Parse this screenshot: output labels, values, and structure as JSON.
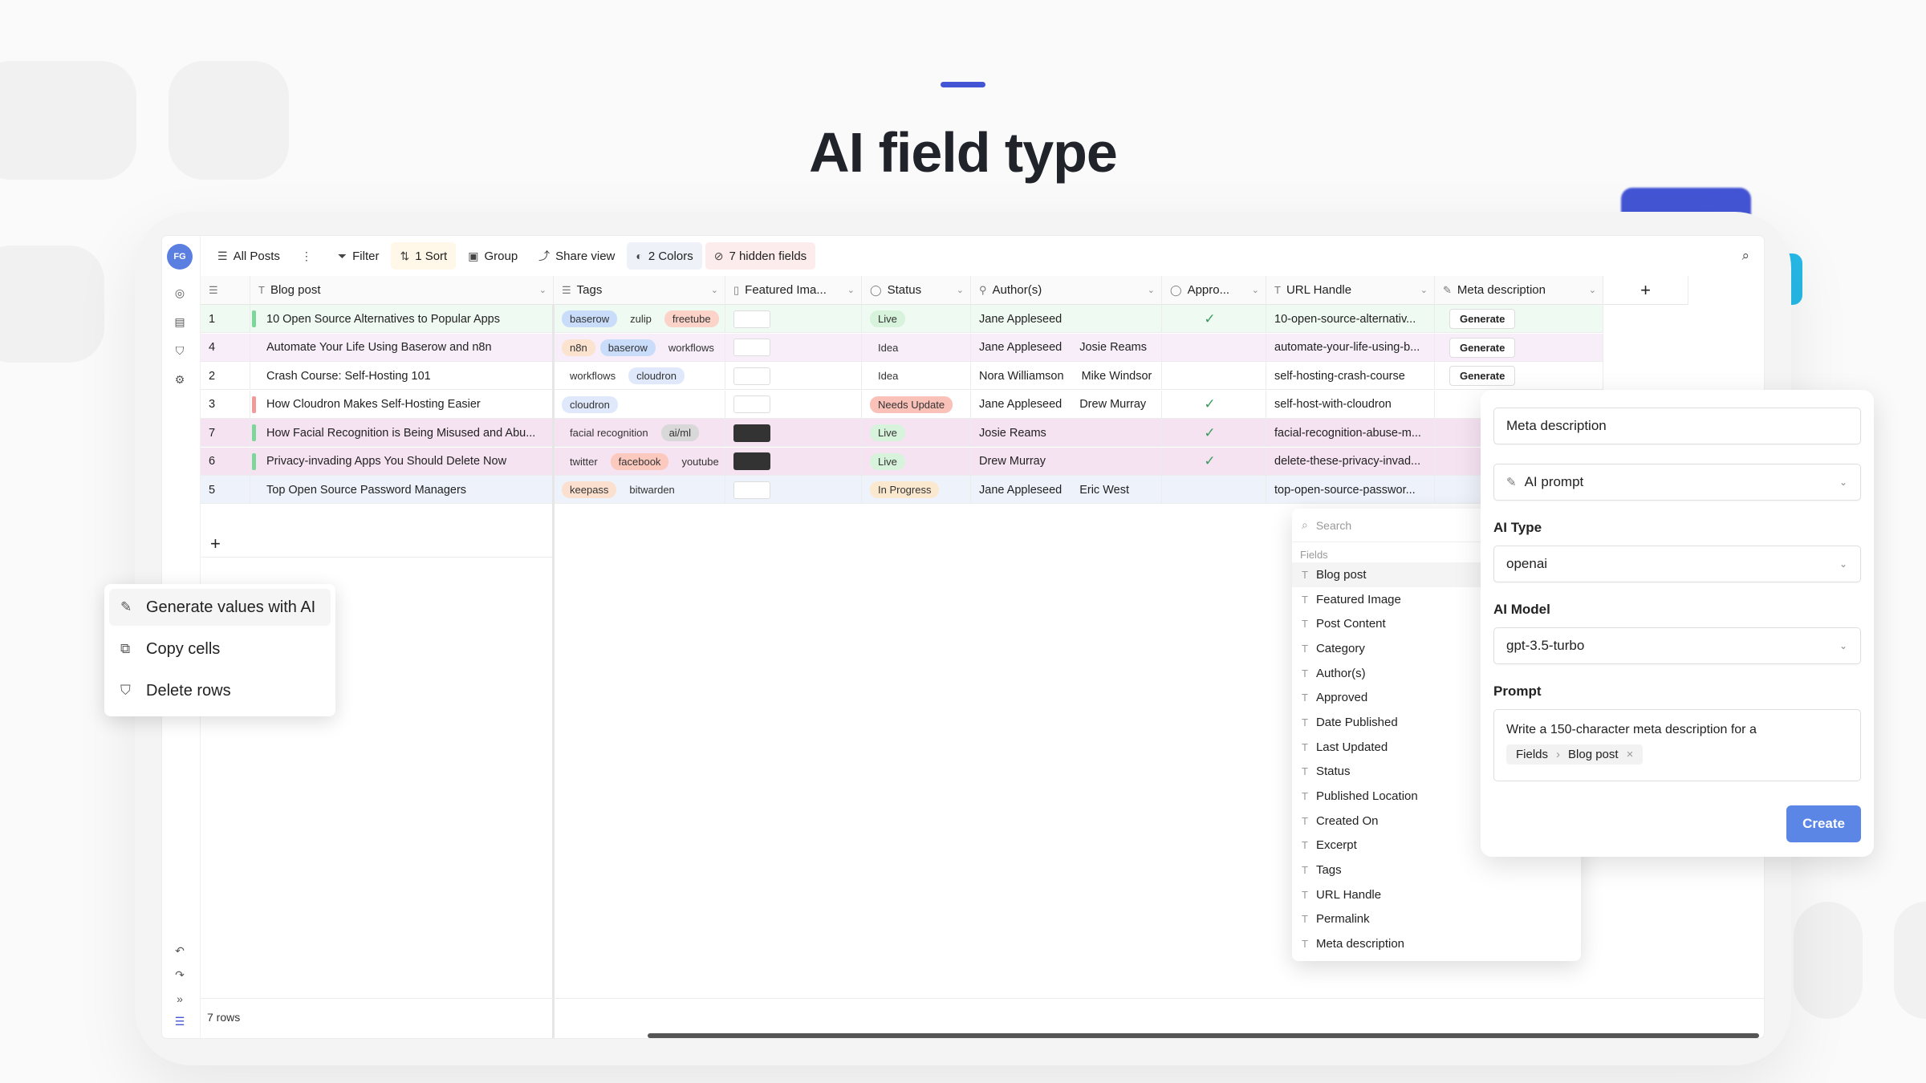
{
  "hero": {
    "title": "AI field type"
  },
  "sidebar": {
    "avatar": "FG"
  },
  "toolbar": {
    "view_name": "All Posts",
    "filter": "Filter",
    "sort": "1 Sort",
    "group": "Group",
    "share": "Share view",
    "colors": "2 Colors",
    "hidden": "7 hidden fields"
  },
  "columns": [
    "Blog post",
    "Tags",
    "Featured Ima...",
    "Status",
    "Author(s)",
    "Appro...",
    "URL Handle",
    "Meta description"
  ],
  "rows": [
    {
      "id": "1",
      "title": "10 Open Source Alternatives to Popular Apps",
      "tags": [
        "baserow",
        "zulip",
        "freetube"
      ],
      "status": "Live",
      "authors": [
        "Jane Appleseed"
      ],
      "approved": "✓",
      "url": "10-open-source-alternativ...",
      "meta": "Generate"
    },
    {
      "id": "4",
      "title": "Automate Your Life Using Baserow and n8n",
      "tags": [
        "n8n",
        "baserow",
        "workflows"
      ],
      "status": "Idea",
      "authors": [
        "Jane Appleseed",
        "Josie Reams"
      ],
      "approved": "",
      "url": "automate-your-life-using-b...",
      "meta": "Generate"
    },
    {
      "id": "2",
      "title": "Crash Course: Self-Hosting 101",
      "tags": [
        "workflows",
        "cloudron"
      ],
      "status": "Idea",
      "authors": [
        "Nora Williamson",
        "Mike Windsor"
      ],
      "approved": "",
      "url": "self-hosting-crash-course",
      "meta": "Generate"
    },
    {
      "id": "3",
      "title": "How Cloudron Makes Self-Hosting Easier",
      "tags": [
        "cloudron"
      ],
      "status": "Needs Update",
      "authors": [
        "Jane Appleseed",
        "Drew Murray"
      ],
      "approved": "✓",
      "url": "self-host-with-cloudron",
      "meta": ""
    },
    {
      "id": "7",
      "title": "How Facial Recognition is Being Misused and Abu...",
      "tags": [
        "facial recognition",
        "ai/ml"
      ],
      "status": "Live",
      "authors": [
        "Josie Reams"
      ],
      "approved": "✓",
      "url": "facial-recognition-abuse-m...",
      "meta": ""
    },
    {
      "id": "6",
      "title": "Privacy-invading Apps You Should Delete Now",
      "tags": [
        "twitter",
        "facebook",
        "youtube"
      ],
      "status": "Live",
      "authors": [
        "Drew Murray"
      ],
      "approved": "✓",
      "url": "delete-these-privacy-invad...",
      "meta": ""
    },
    {
      "id": "5",
      "title": "Top Open Source Password Managers",
      "tags": [
        "keepass",
        "bitwarden"
      ],
      "status": "In Progress",
      "authors": [
        "Jane Appleseed",
        "Eric West"
      ],
      "approved": "",
      "url": "top-open-source-passwor...",
      "meta": ""
    }
  ],
  "footer": {
    "row_count": "7 rows"
  },
  "context_menu": {
    "items": [
      "Generate values with AI",
      "Copy cells",
      "Delete rows"
    ]
  },
  "field_dropdown": {
    "search_placeholder": "Search",
    "group_label": "Fields",
    "items": [
      "Blog post",
      "Featured Image",
      "Post Content",
      "Category",
      "Author(s)",
      "Approved",
      "Date Published",
      "Last Updated",
      "Status",
      "Published Location",
      "Created On",
      "Excerpt",
      "Tags",
      "URL Handle",
      "Permalink",
      "Meta description"
    ]
  },
  "panel": {
    "field_name": "Meta description",
    "field_type": "AI prompt",
    "ai_type_label": "AI Type",
    "ai_type": "openai",
    "ai_model_label": "AI Model",
    "ai_model": "gpt-3.5-turbo",
    "prompt_label": "Prompt",
    "prompt_text": "Write a 150-character meta description for a",
    "chip_group": "Fields",
    "chip_field": "Blog post",
    "chip_remove": "×",
    "create": "Create"
  },
  "colors": {
    "accent": "#4355d4",
    "create_button": "#5b86e5",
    "cyan": "#26b9e8"
  }
}
